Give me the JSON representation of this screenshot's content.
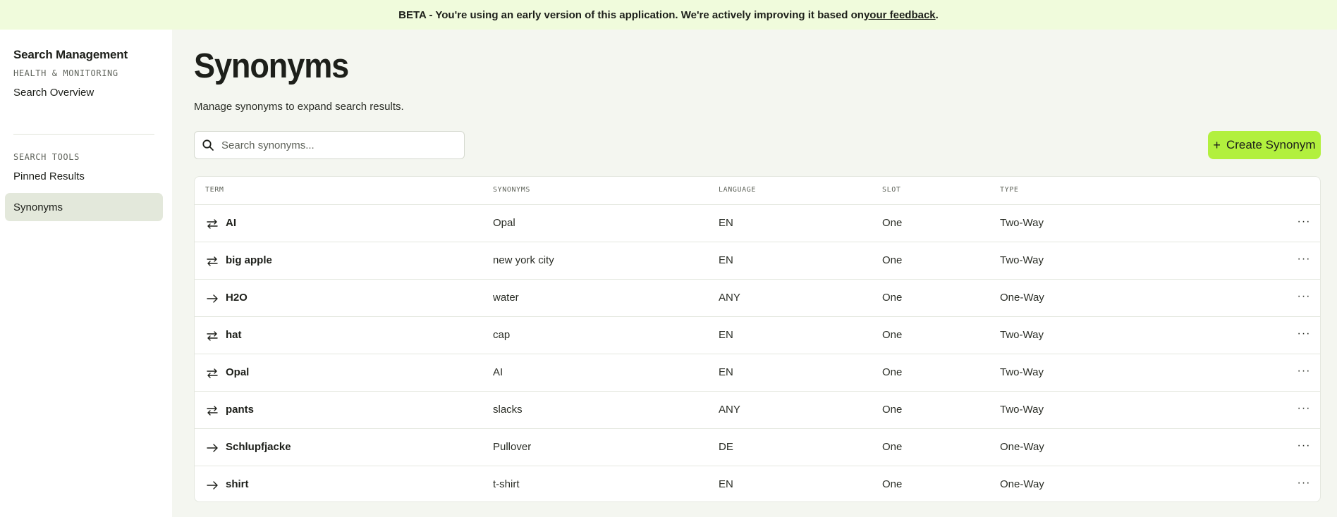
{
  "banner": {
    "text": "BETA - You're using an early version of this application. We're actively improving it based on ",
    "link": "your feedback",
    "end": "."
  },
  "sidebar": {
    "app_title": "Search Management",
    "sections": [
      {
        "label": "HEALTH & MONITORING",
        "items": [
          {
            "label": "Search Overview",
            "active": false
          }
        ]
      },
      {
        "label": "SEARCH TOOLS",
        "items": [
          {
            "label": "Pinned Results",
            "active": false
          },
          {
            "label": "Synonyms",
            "active": true
          }
        ]
      }
    ]
  },
  "main": {
    "title": "Synonyms",
    "subtitle": "Manage synonyms to expand search results.",
    "search": {
      "placeholder": "Search synonyms...",
      "icon": "search-icon"
    },
    "create_button": {
      "label": "Create Synonym",
      "icon": "plus-icon"
    }
  },
  "table": {
    "columns": [
      "TERM",
      "SYNONYMS",
      "LANGUAGE",
      "SLOT",
      "TYPE"
    ],
    "rows": [
      {
        "icon": "two-way-arrows-icon",
        "term": "AI",
        "synonyms": "Opal",
        "language": "EN",
        "slot": "One",
        "type": "Two-Way"
      },
      {
        "icon": "two-way-arrows-icon",
        "term": "big apple",
        "synonyms": "new york city",
        "language": "EN",
        "slot": "One",
        "type": "Two-Way"
      },
      {
        "icon": "one-way-arrow-icon",
        "term": "H2O",
        "synonyms": "water",
        "language": "ANY",
        "slot": "One",
        "type": "One-Way"
      },
      {
        "icon": "two-way-arrows-icon",
        "term": "hat",
        "synonyms": "cap",
        "language": "EN",
        "slot": "One",
        "type": "Two-Way"
      },
      {
        "icon": "two-way-arrows-icon",
        "term": "Opal",
        "synonyms": "AI",
        "language": "EN",
        "slot": "One",
        "type": "Two-Way"
      },
      {
        "icon": "two-way-arrows-icon",
        "term": "pants",
        "synonyms": "slacks",
        "language": "ANY",
        "slot": "One",
        "type": "Two-Way"
      },
      {
        "icon": "one-way-arrow-icon",
        "term": "Schlupfjacke",
        "synonyms": "Pullover",
        "language": "DE",
        "slot": "One",
        "type": "One-Way"
      },
      {
        "icon": "one-way-arrow-icon",
        "term": "shirt",
        "synonyms": "t-shirt",
        "language": "EN",
        "slot": "One",
        "type": "One-Way"
      }
    ],
    "row_action_label": "···"
  },
  "colors": {
    "banner_bg": "#f0fbdc",
    "page_bg": "#f4f6f0",
    "accent": "#b2f03e",
    "active_nav_bg": "#e3e8db"
  }
}
